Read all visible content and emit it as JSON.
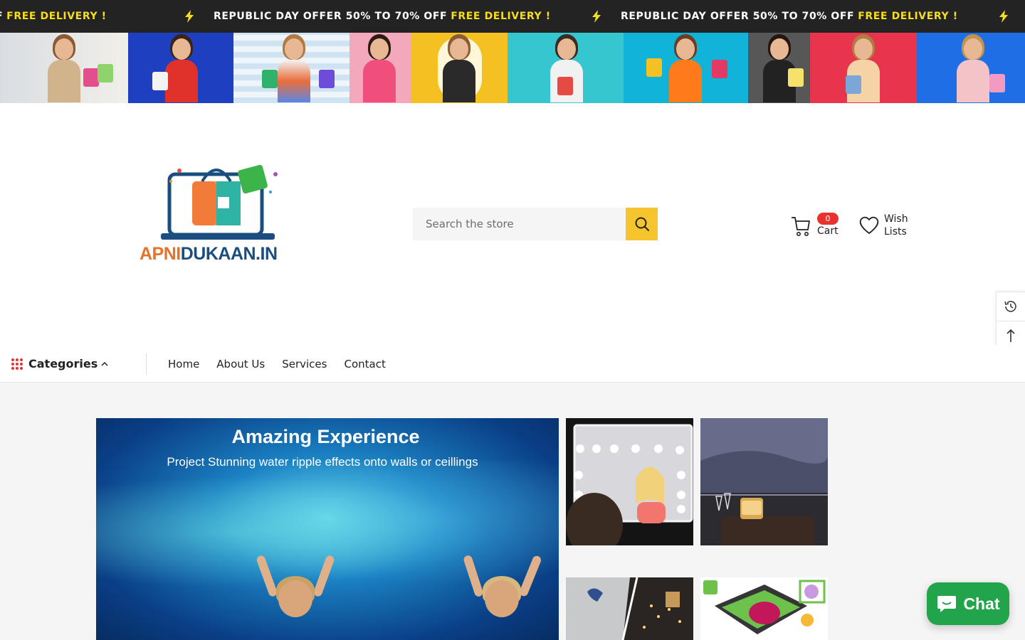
{
  "announcement": {
    "text": "REPUBLIC DAY OFFER 50% TO 70% OFF",
    "highlight": "FREE DELIVERY !",
    "highlight_color": "#f5dd21",
    "background": "#232323",
    "icon": "lightning-bolt-icon"
  },
  "banner": {
    "description_icons": [
      "shopping-woman-image"
    ]
  },
  "header": {
    "logo": {
      "part1": "APNI",
      "part2": "DUKAAN.IN"
    },
    "search": {
      "placeholder": "Search the store",
      "icon": "search-icon",
      "button_color": "#f6c52d"
    },
    "cart": {
      "label": "Cart",
      "count": "0",
      "icon": "cart-icon",
      "badge_color": "#e9312d"
    },
    "wishlist": {
      "label": "Wish Lists",
      "icon": "heart-icon"
    }
  },
  "side_tools": {
    "recent_icon": "history-icon",
    "top_icon": "arrow-up-icon"
  },
  "nav": {
    "categories_label": "Categories",
    "items": [
      {
        "label": "Home"
      },
      {
        "label": "About Us"
      },
      {
        "label": "Services"
      },
      {
        "label": "Contact"
      }
    ]
  },
  "hero": {
    "title": "Amazing Experience",
    "subtitle": "Project Stunning water ripple effects onto walls or ceillings"
  },
  "chat": {
    "label": "Chat",
    "color": "#22a44b",
    "icon": "chat-bubble-icon"
  }
}
